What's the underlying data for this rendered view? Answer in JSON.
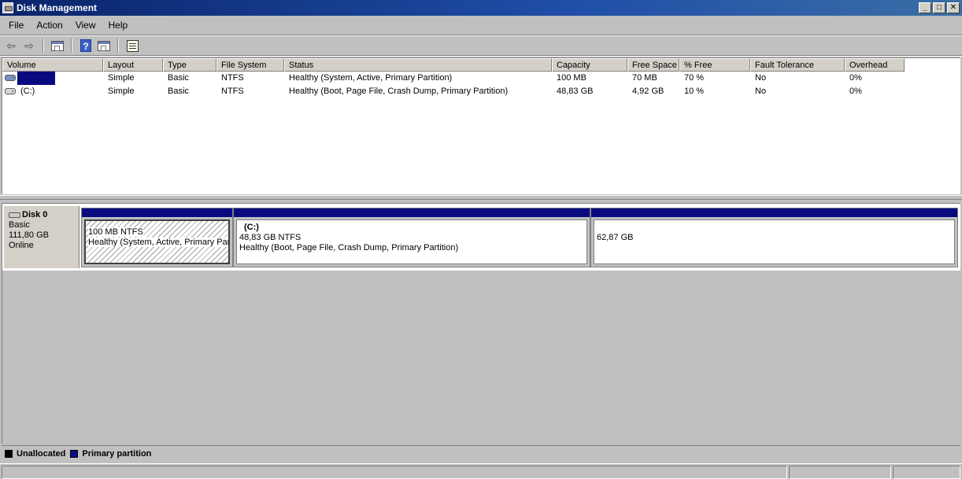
{
  "window": {
    "title": "Disk Management",
    "minimize": "_",
    "maximize": "□",
    "close": "✕"
  },
  "menu": [
    "File",
    "Action",
    "View",
    "Help"
  ],
  "toolbar": {
    "back": "⇦",
    "forward": "⇨",
    "help": "?"
  },
  "volume_list": {
    "columns": [
      "Volume",
      "Layout",
      "Type",
      "File System",
      "Status",
      "Capacity",
      "Free Space",
      "% Free",
      "Fault Tolerance",
      "Overhead"
    ],
    "rows": [
      {
        "volume": "",
        "layout": "Simple",
        "type": "Basic",
        "fs": "NTFS",
        "status": "Healthy (System, Active, Primary Partition)",
        "capacity": "100 MB",
        "free": "70 MB",
        "pct": "70 %",
        "fault": "No",
        "overhead": "0%"
      },
      {
        "volume": "(C:)",
        "layout": "Simple",
        "type": "Basic",
        "fs": "NTFS",
        "status": "Healthy (Boot, Page File, Crash Dump, Primary Partition)",
        "capacity": "48,83 GB",
        "free": "4,92 GB",
        "pct": "10 %",
        "fault": "No",
        "overhead": "0%"
      }
    ]
  },
  "disk": {
    "name": "Disk 0",
    "type": "Basic",
    "size": "111,80 GB",
    "state": "Online",
    "partitions": [
      {
        "name": "",
        "size_fs": "100 MB NTFS",
        "status": "Healthy (System, Active, Primary Par"
      },
      {
        "name": "(C:)",
        "size_fs": "48,83 GB NTFS",
        "status": "Healthy (Boot, Page File, Crash Dump, Primary Partition)"
      },
      {
        "name": "",
        "size_fs": "62,87 GB",
        "status": ""
      }
    ]
  },
  "legend": {
    "items": [
      {
        "label": "Unallocated",
        "color": "#000000"
      },
      {
        "label": "Primary partition",
        "color": "#0a0a80"
      }
    ]
  }
}
